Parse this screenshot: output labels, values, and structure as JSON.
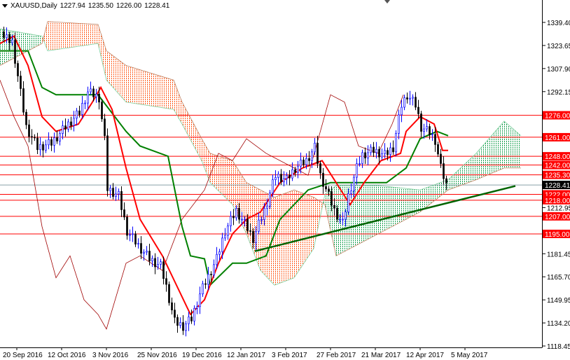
{
  "header": {
    "symbol": "XAUUSD,Daily",
    "open": "1227.94",
    "high": "1235.50",
    "low": "1226.00",
    "close": "1228.41"
  },
  "chart_data": {
    "type": "candlestick-ichimoku",
    "title": "XAUUSD,Daily",
    "ylim": [
      1112,
      1352
    ],
    "price_ticks": [
      "1339.40",
      "1323.65",
      "1307.90",
      "1292.15",
      "1212.95",
      "1181.45",
      "1165.70",
      "1149.95",
      "1134.20",
      "1118.45"
    ],
    "date_ticks": [
      {
        "bar": 6,
        "label": "20 Sep 2016"
      },
      {
        "bar": 22,
        "label": "12 Oct 2016"
      },
      {
        "bar": 38,
        "label": "3 Nov 2016"
      },
      {
        "bar": 54,
        "label": "25 Nov 2016"
      },
      {
        "bar": 70,
        "label": "19 Dec 2016"
      },
      {
        "bar": 86,
        "label": "12 Jan 2017"
      },
      {
        "bar": 102,
        "label": "3 Feb 2017"
      },
      {
        "bar": 118,
        "label": "27 Feb 2017"
      },
      {
        "bar": 134,
        "label": "21 Mar 2017"
      },
      {
        "bar": 150,
        "label": "12 Apr 2017"
      },
      {
        "bar": 166,
        "label": "5 May 2017"
      }
    ],
    "levels": [
      {
        "price": 1276.0,
        "label": "1276.00"
      },
      {
        "price": 1261.0,
        "label": "1261.00"
      },
      {
        "price": 1248.0,
        "label": "1248.00"
      },
      {
        "price": 1242.0,
        "label": "1242.00"
      },
      {
        "price": 1235.3,
        "label": "1235.30"
      },
      {
        "price": 1222.0,
        "label": "1222.00"
      },
      {
        "price": 1218.0,
        "label": "1218.00"
      },
      {
        "price": 1207.0,
        "label": "1207.00"
      },
      {
        "price": 1195.0,
        "label": "1195.00"
      }
    ],
    "current_price": {
      "price": 1228.41,
      "label": "1228.41"
    },
    "closes": [
      [
        1,
        1330
      ],
      [
        5,
        1326
      ],
      [
        10,
        1268
      ],
      [
        14,
        1254
      ],
      [
        19,
        1257
      ],
      [
        24,
        1268
      ],
      [
        29,
        1278
      ],
      [
        32,
        1292
      ],
      [
        36,
        1288
      ],
      [
        38,
        1259
      ],
      [
        39,
        1226
      ],
      [
        43,
        1221
      ],
      [
        46,
        1197
      ],
      [
        50,
        1187
      ],
      [
        54,
        1178
      ],
      [
        58,
        1173
      ],
      [
        60,
        1159
      ],
      [
        63,
        1135
      ],
      [
        66,
        1132
      ],
      [
        69,
        1137
      ],
      [
        72,
        1154
      ],
      [
        75,
        1166
      ],
      [
        78,
        1178
      ],
      [
        81,
        1197
      ],
      [
        85,
        1211
      ],
      [
        88,
        1202
      ],
      [
        91,
        1192
      ],
      [
        95,
        1211
      ],
      [
        99,
        1235
      ],
      [
        103,
        1232
      ],
      [
        106,
        1240
      ],
      [
        110,
        1245
      ],
      [
        113,
        1254
      ],
      [
        115,
        1235
      ],
      [
        118,
        1221
      ],
      [
        120,
        1211
      ],
      [
        123,
        1202
      ],
      [
        125,
        1221
      ],
      [
        128,
        1240
      ],
      [
        130,
        1249
      ],
      [
        134,
        1252
      ],
      [
        138,
        1249
      ],
      [
        141,
        1254
      ],
      [
        144,
        1283
      ],
      [
        146,
        1290
      ],
      [
        149,
        1283
      ],
      [
        151,
        1268
      ],
      [
        154,
        1264
      ],
      [
        156,
        1259
      ],
      [
        158,
        1240
      ],
      [
        160,
        1228.41
      ]
    ],
    "tenkan": [
      [
        0,
        1325
      ],
      [
        5,
        1330
      ],
      [
        10,
        1310
      ],
      [
        15,
        1275
      ],
      [
        20,
        1265
      ],
      [
        28,
        1270
      ],
      [
        33,
        1285
      ],
      [
        36,
        1295
      ],
      [
        40,
        1280
      ],
      [
        45,
        1240
      ],
      [
        50,
        1205
      ],
      [
        58,
        1180
      ],
      [
        63,
        1160
      ],
      [
        68,
        1140
      ],
      [
        73,
        1150
      ],
      [
        78,
        1175
      ],
      [
        83,
        1195
      ],
      [
        88,
        1205
      ],
      [
        93,
        1210
      ],
      [
        100,
        1230
      ],
      [
        108,
        1240
      ],
      [
        115,
        1245
      ],
      [
        120,
        1230
      ],
      [
        125,
        1215
      ],
      [
        130,
        1230
      ],
      [
        136,
        1245
      ],
      [
        143,
        1250
      ],
      [
        145,
        1265
      ],
      [
        150,
        1275
      ],
      [
        155,
        1270
      ],
      [
        158,
        1252
      ],
      [
        160,
        1252
      ]
    ],
    "kijun": [
      [
        0,
        1320
      ],
      [
        10,
        1320
      ],
      [
        15,
        1295
      ],
      [
        20,
        1290
      ],
      [
        35,
        1290
      ],
      [
        45,
        1265
      ],
      [
        50,
        1255
      ],
      [
        60,
        1248
      ],
      [
        65,
        1200
      ],
      [
        68,
        1180
      ],
      [
        73,
        1178
      ],
      [
        75,
        1160
      ],
      [
        83,
        1175
      ],
      [
        88,
        1175
      ],
      [
        95,
        1180
      ],
      [
        100,
        1205
      ],
      [
        110,
        1225
      ],
      [
        118,
        1230
      ],
      [
        128,
        1230
      ],
      [
        138,
        1230
      ],
      [
        145,
        1240
      ],
      [
        150,
        1260
      ],
      [
        156,
        1265
      ],
      [
        160,
        1262
      ]
    ],
    "chikou": [
      [
        0,
        1300
      ],
      [
        5,
        1275
      ],
      [
        10,
        1255
      ],
      [
        15,
        1200
      ],
      [
        20,
        1165
      ],
      [
        25,
        1180
      ],
      [
        30,
        1150
      ],
      [
        35,
        1140
      ],
      [
        38,
        1130
      ],
      [
        45,
        1175
      ],
      [
        50,
        1180
      ],
      [
        58,
        1170
      ],
      [
        65,
        1205
      ],
      [
        73,
        1225
      ],
      [
        78,
        1250
      ],
      [
        83,
        1245
      ],
      [
        88,
        1260
      ],
      [
        95,
        1250
      ],
      [
        105,
        1240
      ],
      [
        110,
        1235
      ],
      [
        118,
        1290
      ],
      [
        123,
        1285
      ],
      [
        128,
        1255
      ],
      [
        135,
        1250
      ],
      [
        140,
        1270
      ],
      [
        144,
        1290
      ]
    ],
    "span_a": [
      [
        0,
        1335
      ],
      [
        15,
        1330
      ],
      [
        17,
        1320
      ],
      [
        35,
        1325
      ],
      [
        38,
        1300
      ],
      [
        45,
        1285
      ],
      [
        62,
        1280
      ],
      [
        65,
        1270
      ],
      [
        72,
        1245
      ],
      [
        75,
        1230
      ],
      [
        83,
        1215
      ],
      [
        88,
        1195
      ],
      [
        93,
        1170
      ],
      [
        98,
        1160
      ],
      [
        105,
        1165
      ],
      [
        112,
        1185
      ],
      [
        116,
        1222
      ],
      [
        120,
        1228
      ],
      [
        135,
        1228
      ],
      [
        150,
        1225
      ],
      [
        160,
        1232
      ],
      [
        170,
        1250
      ],
      [
        180,
        1272
      ],
      [
        186,
        1262
      ]
    ],
    "span_b": [
      [
        0,
        1310
      ],
      [
        15,
        1325
      ],
      [
        17,
        1340
      ],
      [
        35,
        1338
      ],
      [
        38,
        1320
      ],
      [
        45,
        1310
      ],
      [
        62,
        1300
      ],
      [
        65,
        1285
      ],
      [
        72,
        1260
      ],
      [
        75,
        1250
      ],
      [
        83,
        1245
      ],
      [
        88,
        1230
      ],
      [
        93,
        1225
      ],
      [
        98,
        1220
      ],
      [
        105,
        1225
      ],
      [
        112,
        1220
      ],
      [
        116,
        1215
      ],
      [
        120,
        1180
      ],
      [
        135,
        1195
      ],
      [
        150,
        1210
      ],
      [
        160,
        1225
      ],
      [
        170,
        1232
      ],
      [
        180,
        1240
      ],
      [
        186,
        1240
      ]
    ],
    "trendline": [
      [
        91,
        1183.2
      ],
      [
        184,
        1227.7
      ]
    ],
    "colors": {
      "level": "#ff0000",
      "tenkan": "#ff0000",
      "kijun": "#008000",
      "chikou": "#a00000",
      "bull_cloud": "#00a040",
      "bear_cloud": "#ff4500",
      "trendline": "#006400",
      "up": "#0000ff",
      "down": "#000000"
    }
  }
}
